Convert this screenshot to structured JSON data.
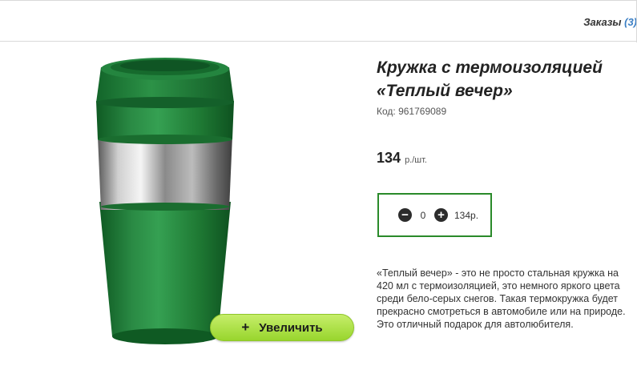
{
  "header": {
    "orders_label": "Заказы",
    "orders_count": "(3)"
  },
  "product": {
    "title": "Кружка с термоизоляцией «Теплый вечер»",
    "code": "Код: 961769089",
    "price_value": "134",
    "price_unit": "р./шт.",
    "quantity": "0",
    "total": "134р.",
    "description": "«Теплый вечер» - это не просто стальная кружка на 420 мл с термоизоляцией, это немного яркого цвета среди бело-серых снегов. Такая термокружка будет прекрасно смотреться в автомобиле или на природе. Это отличный подарок для автолюбителя.",
    "zoom_label": "Увеличить",
    "zoom_icon": "+"
  },
  "icons": {
    "minus": "minus-circle-icon",
    "plus": "plus-circle-icon"
  },
  "colors": {
    "mug_green": "#1f7a34",
    "box_border": "#2a8a2a",
    "button_green": "#a8df3d",
    "link_blue": "#3a7ec4"
  }
}
